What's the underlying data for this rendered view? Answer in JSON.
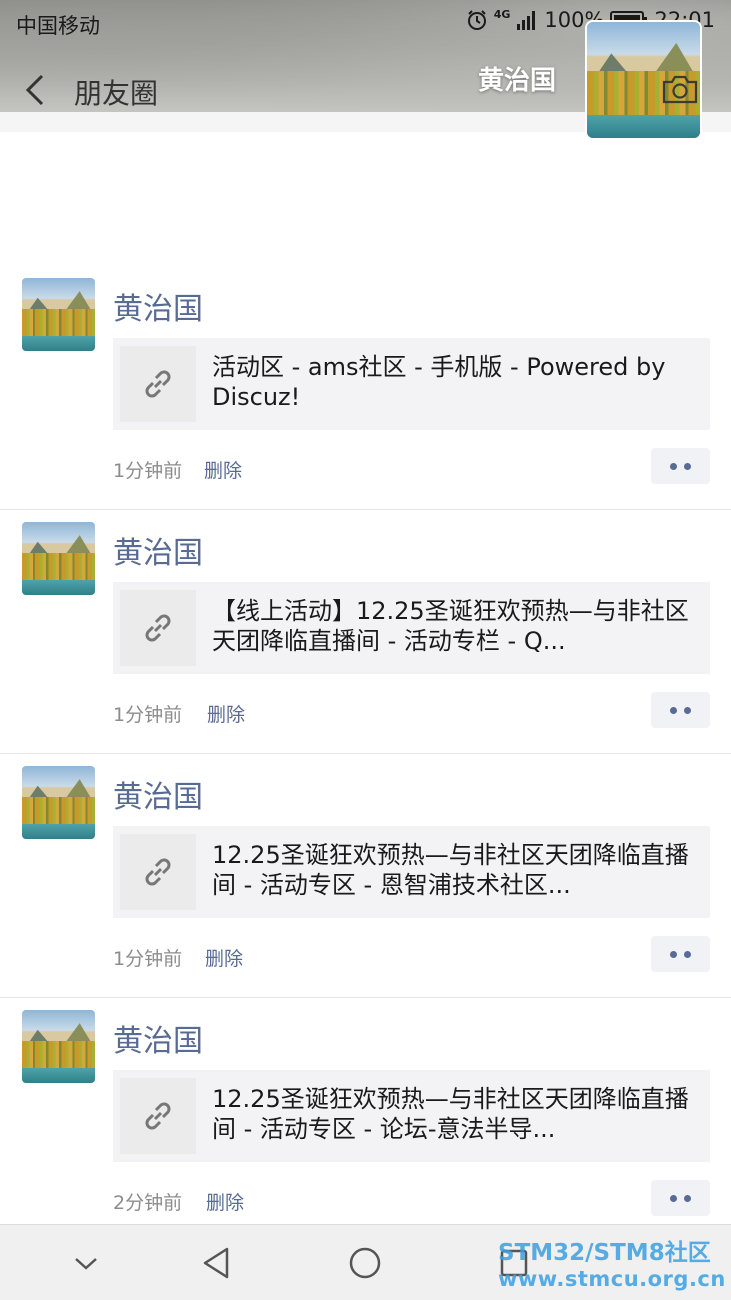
{
  "status_bar": {
    "carrier": "中国移动",
    "network": "4G",
    "battery": "100%",
    "time": "22:01"
  },
  "nav": {
    "back_label": "",
    "title": "朋友圈",
    "cover_name": "黄治国"
  },
  "posts": [
    {
      "name": "黄治国",
      "link_title": "活动区 - ams社区 - 手机版 - Powered by Discuz!",
      "time": "1分钟前",
      "delete_label": "删除"
    },
    {
      "name": "黄治国",
      "link_title": "【线上活动】12.25圣诞狂欢预热—与非社区天团降临直播间 - 活动专栏 - Q...",
      "time": "1分钟前",
      "delete_label": "删除"
    },
    {
      "name": "黄治国",
      "link_title": "12.25圣诞狂欢预热—与非社区天团降临直播间 - 活动专区 - 恩智浦技术社区...",
      "time": "1分钟前",
      "delete_label": "删除"
    },
    {
      "name": "黄治国",
      "link_title": "12.25圣诞狂欢预热—与非社区天团降临直播间 - 活动专区 - 论坛-意法半导...",
      "time": "2分钟前",
      "delete_label": "删除"
    }
  ],
  "watermark": {
    "line1": "STM32/STM8社区",
    "line2": "www.stmcu.org.cn"
  },
  "colors": {
    "name_link": "#576b95",
    "card_bg": "#f3f3f5",
    "time_text": "#8c8c8c"
  },
  "icons": {
    "back": "chevron-left-icon",
    "camera": "camera-icon",
    "link": "link-icon",
    "more": "more-dots-icon",
    "alarm": "alarm-icon",
    "signal": "signal-icon",
    "battery": "battery-icon",
    "sys_back": "triangle-back-icon",
    "sys_home": "circle-home-icon",
    "sys_recent": "square-recent-icon",
    "sys_hide": "chevron-down-icon"
  }
}
